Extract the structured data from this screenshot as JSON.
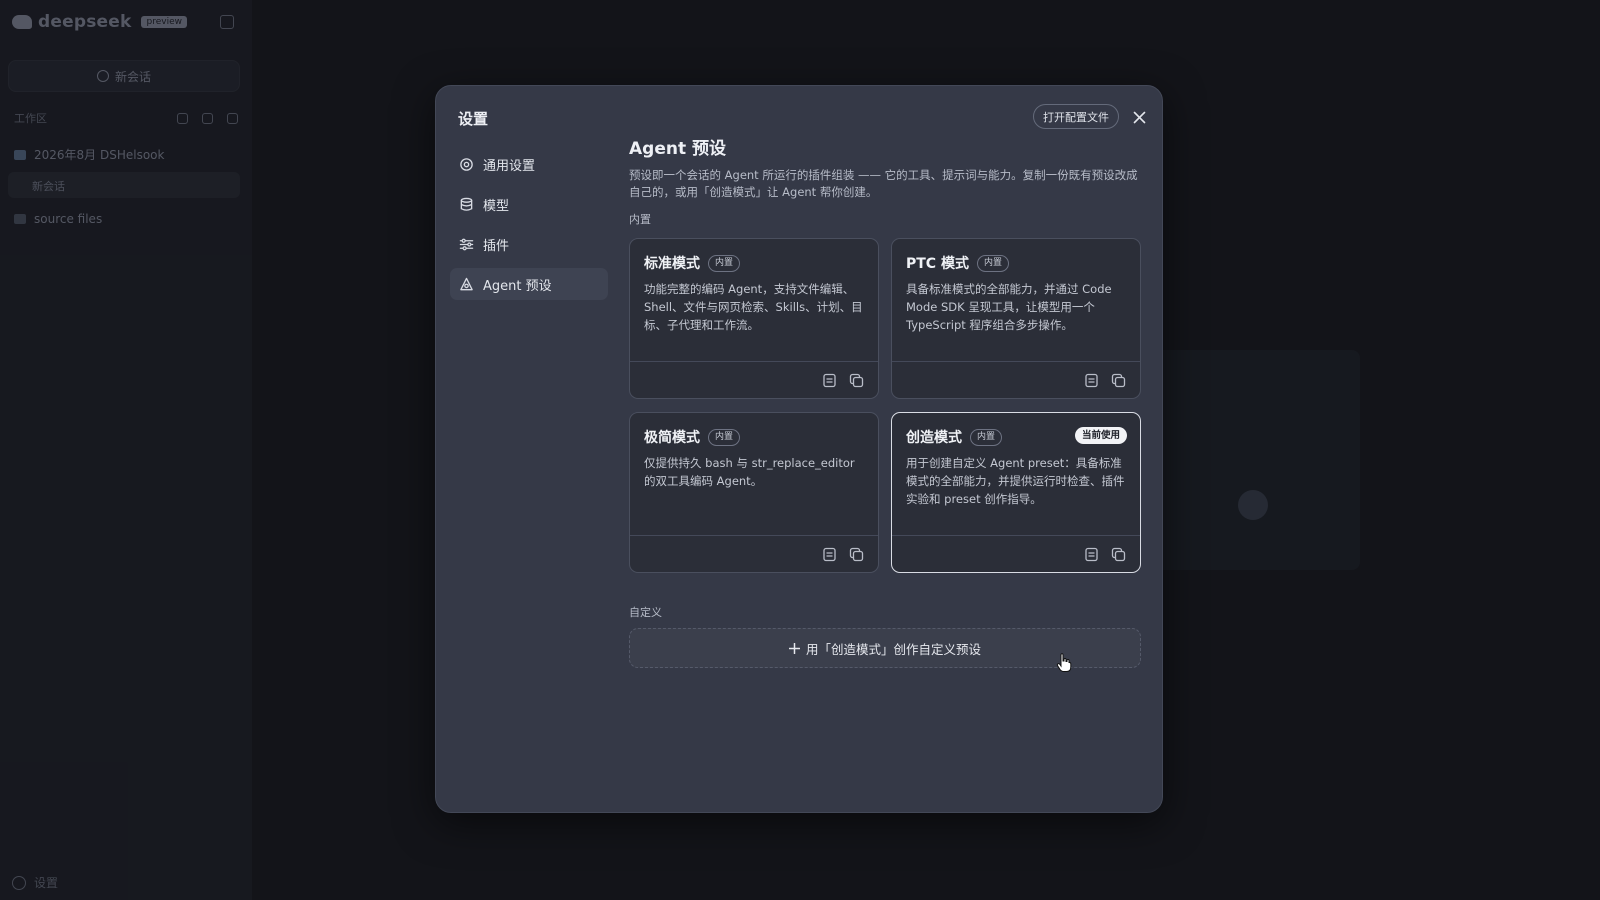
{
  "background_app": {
    "logo_text": "deepseek",
    "logo_badge": "preview",
    "new_chat_label": "新会话",
    "section_label": "工作区",
    "folder_1": "2026年8月 DSHelsook",
    "chat_item": "新会话",
    "folder_2": "source files",
    "settings_label": "设置"
  },
  "modal": {
    "title": "设置",
    "open_config_label": "打开配置文件",
    "close_icon": "close-icon"
  },
  "nav": {
    "items": [
      {
        "label": "通用设置",
        "icon": "gear-icon"
      },
      {
        "label": "模型",
        "icon": "database-icon"
      },
      {
        "label": "插件",
        "icon": "sliders-icon"
      },
      {
        "label": "Agent 预设",
        "icon": "agent-icon",
        "active": true
      }
    ]
  },
  "content": {
    "title": "Agent 预设",
    "description": "预设即一个会话的 Agent 所运行的插件组装 —— 它的工具、提示词与能力。复制一份既有预设改成自己的，或用「创造模式」让 Agent 帮你创建。",
    "builtin_label": "内置",
    "custom_label": "自定义",
    "create_custom_label": "用「创造模式」创作自定义预设"
  },
  "presets": [
    {
      "name": "标准模式",
      "tag": "内置",
      "description": "功能完整的编码 Agent，支持文件编辑、Shell、文件与网页检索、Skills、计划、目标、子代理和工作流。",
      "current": false
    },
    {
      "name": "PTC 模式",
      "tag": "内置",
      "description": "具备标准模式的全部能力，并通过 Code Mode SDK 呈现工具，让模型用一个 TypeScript 程序组合多步操作。",
      "current": false
    },
    {
      "name": "极简模式",
      "tag": "内置",
      "description": "仅提供持久 bash 与 str_replace_editor 的双工具编码 Agent。",
      "current": false
    },
    {
      "name": "创造模式",
      "tag": "内置",
      "description": "用于创建自定义 Agent preset：具备标准模式的全部能力，并提供运行时检查、插件实验和 preset 创作指导。",
      "current": true,
      "current_label": "当前使用"
    }
  ],
  "colors": {
    "modal_bg": "#353947",
    "card_bg": "#2b2e38",
    "page_bg": "#131419",
    "badge_bg": "#f2f3f6"
  }
}
